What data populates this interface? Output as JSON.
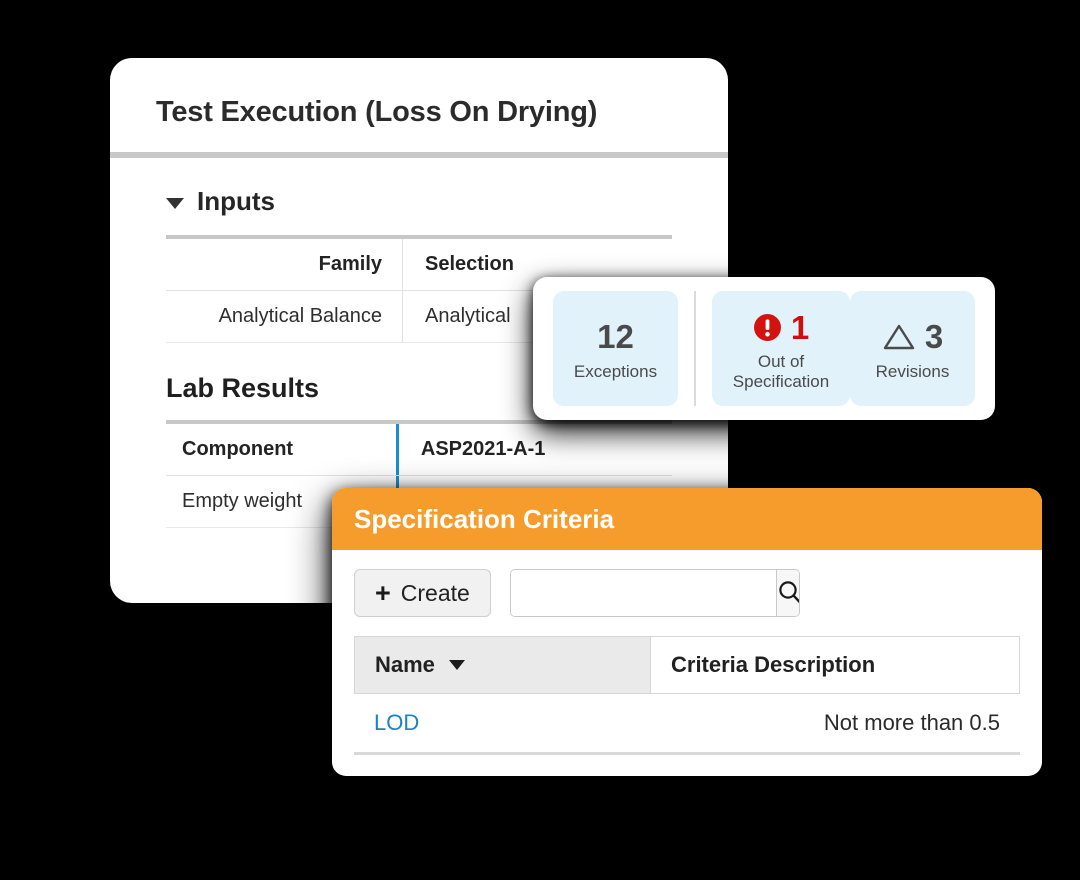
{
  "test_execution": {
    "title": "Test Execution (Loss On Drying)",
    "inputs_section": {
      "label": "Inputs",
      "chevron_icon": "chevron-down-icon",
      "columns": [
        "Family",
        "Selection"
      ],
      "rows": [
        {
          "family": "Analytical Balance",
          "selection": "Analytical"
        }
      ]
    },
    "lab_results": {
      "title": "Lab Results",
      "columns": [
        "Component",
        "ASP2021-A-1"
      ],
      "rows": [
        {
          "component": "Empty weight",
          "value": ""
        }
      ]
    }
  },
  "stats": {
    "items": [
      {
        "value": "12",
        "label": "Exceptions",
        "icon": "",
        "value_color": "#4a4a4a"
      },
      {
        "value": "1",
        "label": "Out of Specification",
        "icon": "error-circle-icon",
        "value_color": "#d00d0d"
      },
      {
        "value": "3",
        "label": "Revisions",
        "icon": "triangle-outline-icon",
        "value_color": "#4a4a4a"
      }
    ]
  },
  "spec_criteria": {
    "title": "Specification Criteria",
    "header_color": "#f59c2c",
    "toolbar": {
      "create_label": "Create",
      "plus_icon": "plus-icon",
      "search_value": "",
      "search_placeholder": "",
      "search_icon": "search-icon"
    },
    "table": {
      "columns": [
        "Name",
        "Criteria Description"
      ],
      "sort_icon": "sort-descending-caret-icon",
      "rows": [
        {
          "name": "LOD",
          "description": "Not more than 0.5",
          "name_color": "#1b82c4"
        }
      ]
    }
  }
}
